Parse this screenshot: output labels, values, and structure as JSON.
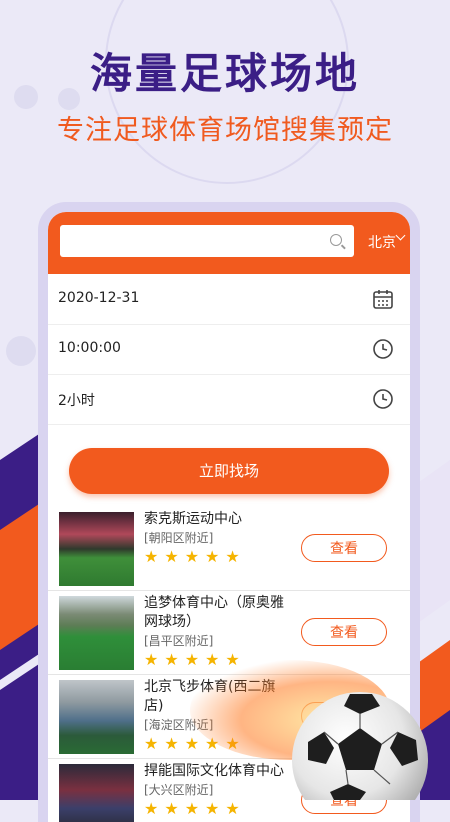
{
  "hero": {
    "title": "海量足球场地",
    "subtitle": "专注足球体育场馆搜集预定"
  },
  "search": {
    "placeholder": "",
    "city": "北京"
  },
  "form": {
    "date": "2020-12-31",
    "time": "10:00:00",
    "duration": "2小时"
  },
  "cta": {
    "label": "立即找场"
  },
  "venues": [
    {
      "name": "索克斯运动中心",
      "area": "[朝阳区附近]",
      "stars": "★★★★★",
      "button": "查看"
    },
    {
      "name": "追梦体育中心（原奥雅网球场）",
      "area": "[昌平区附近]",
      "stars": "★★★★★",
      "button": "查看"
    },
    {
      "name": "北京飞步体育(西二旗店)",
      "area": "[海淀区附近]",
      "stars": "★★★★★",
      "button": "查看"
    },
    {
      "name": "捍能国际文化体育中心",
      "area": "[大兴区附近]",
      "stars": "★★★★★",
      "button": "查看"
    }
  ],
  "colors": {
    "brand": "#f25a1e",
    "title": "#3b1e86",
    "star": "#f5b400"
  }
}
